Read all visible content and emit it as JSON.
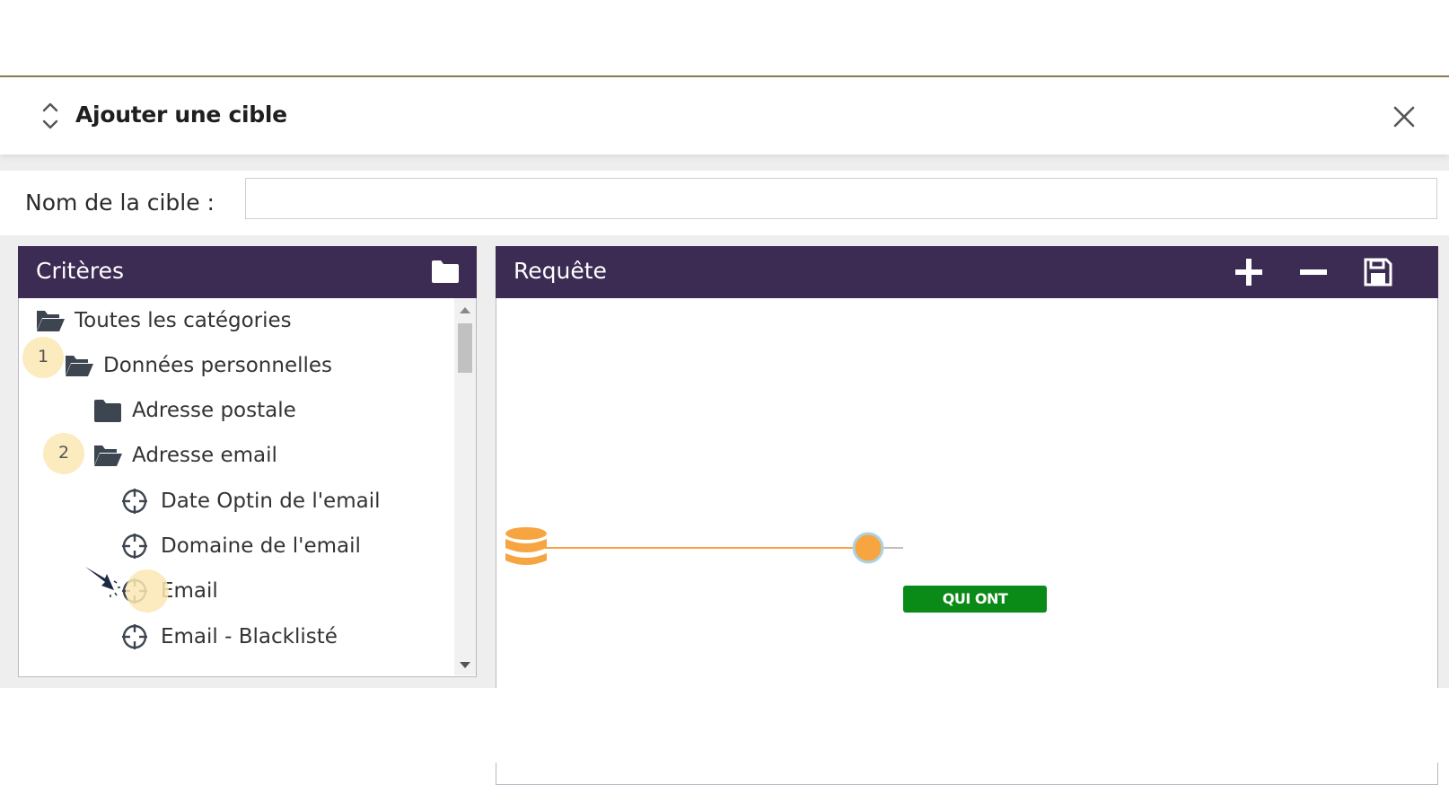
{
  "dialog": {
    "title": "Ajouter une cible"
  },
  "form": {
    "name_label": "Nom de la cible :",
    "name_value": "",
    "name_placeholder": ""
  },
  "criteria": {
    "title": "Critères",
    "tree": [
      {
        "label": "Toutes les catégories",
        "icon": "folder-open-icon"
      },
      {
        "label": "Données personnelles",
        "icon": "folder-open-icon"
      },
      {
        "label": "Adresse postale",
        "icon": "folder-icon"
      },
      {
        "label": "Adresse email",
        "icon": "folder-open-icon"
      },
      {
        "label": "Date Optin de l'email",
        "icon": "crosshair-icon"
      },
      {
        "label": "Domaine de l'email",
        "icon": "crosshair-icon"
      },
      {
        "label": "Email",
        "icon": "crosshair-icon"
      },
      {
        "label": "Email - Blacklisté",
        "icon": "crosshair-icon"
      }
    ],
    "badges": [
      "1",
      "2"
    ]
  },
  "query": {
    "title": "Requête",
    "node_label": "QUI ONT"
  },
  "colors": {
    "header_bg": "#3c2b52",
    "accent_orange": "#f7a540",
    "node_green": "#0a8a16",
    "badge_bg": "#fce8b4"
  }
}
